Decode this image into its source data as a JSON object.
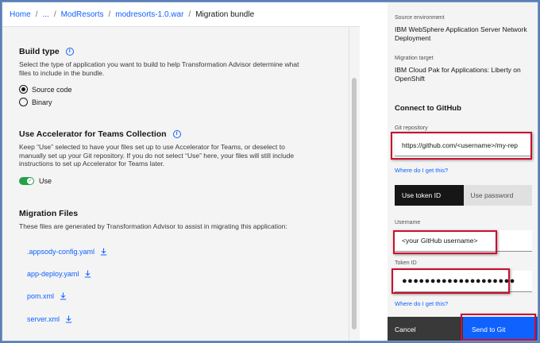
{
  "breadcrumb": {
    "items": [
      "Home",
      "...",
      "ModResorts",
      "modresorts-1.0.war"
    ],
    "separator": "/",
    "current": "Migration bundle"
  },
  "build_type": {
    "title": "Build type",
    "description": "Select the type of application you want to build to help Transformation Advisor determine what files to include in the bundle.",
    "options": [
      {
        "label": "Source code",
        "selected": true
      },
      {
        "label": "Binary",
        "selected": false
      }
    ]
  },
  "accelerator": {
    "title": "Use Accelerator for Teams Collection",
    "description": "Keep “Use” selected to have your files set up to use Accelerator for Teams, or deselect to manually set up your Git repository. If you do not select “Use” here, your files will still include instructions to set up Accelerator for Teams later.",
    "toggle_label": "Use",
    "toggle_on": true
  },
  "migration_files": {
    "title": "Migration Files",
    "description": "These files are generated by Transformation Advisor to assist in migrating this application:",
    "files": [
      ".appsody-config.yaml",
      "app-deploy.yaml",
      "pom.xml",
      "server.xml"
    ]
  },
  "panel": {
    "source_env_label": "Source environment",
    "source_env_value": "IBM WebSphere Application Server Network Deployment",
    "target_label": "Migration target",
    "target_value": "IBM Cloud Pak for Applications: Liberty on OpenShift",
    "github_heading": "Connect to GitHub",
    "repo_label": "Git repository",
    "repo_value": "https://github.com/<username>/my-rep",
    "repo_help": "Where do I get this?",
    "tab_token": "Use token ID",
    "tab_password": "Use password",
    "username_label": "Username",
    "username_value": "<your GitHub username>",
    "token_label": "Token ID",
    "token_value": "●●●●●●●●●●●●●●●●●●●●",
    "token_help": "Where do I get this?",
    "cancel_label": "Cancel",
    "send_label": "Send to Git"
  },
  "colors": {
    "link": "#0f62fe",
    "highlight": "#c8102e",
    "toggle_on": "#24a148"
  }
}
